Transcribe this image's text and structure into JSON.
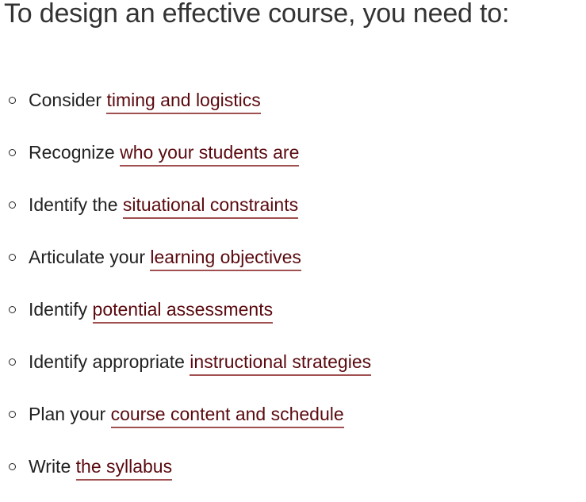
{
  "heading": "To design an effective course, you need to:",
  "items": [
    {
      "prefix": "Consider ",
      "link": "timing and logistics"
    },
    {
      "prefix": "Recognize ",
      "link": "who your students are"
    },
    {
      "prefix": "Identify the ",
      "link": "situational constraints"
    },
    {
      "prefix": "Articulate your ",
      "link": "learning objectives"
    },
    {
      "prefix": "Identify ",
      "link": "potential assessments"
    },
    {
      "prefix": "Identify appropriate ",
      "link": "instructional strategies"
    },
    {
      "prefix": "Plan your ",
      "link": "course content and schedule"
    },
    {
      "prefix": "Write ",
      "link": "the syllabus"
    }
  ],
  "colors": {
    "text": "#222222",
    "link": "#5a0a0f",
    "underline": "#a05050"
  }
}
